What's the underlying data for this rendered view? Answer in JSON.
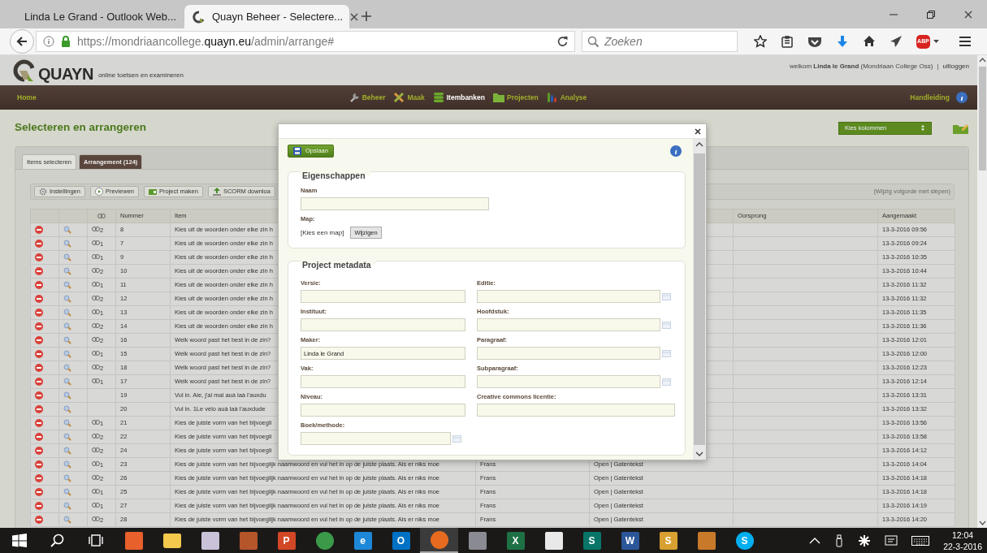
{
  "browser": {
    "tabs": [
      {
        "title": "Linda Le Grand - Outlook Web...",
        "selected": false
      },
      {
        "title": "Quayn Beheer - Selectere...",
        "selected": true
      }
    ],
    "url": {
      "prefix": "https://mondriaancollege.",
      "domain": "quayn.eu",
      "path": "/admin/arrange#"
    },
    "search": {
      "placeholder": "Zoeken"
    },
    "addon_badge": "ABP"
  },
  "header": {
    "logo_text": "QUAYN",
    "tagline": "online toetsen en examineren",
    "welcome": "welkom **Linda le Grand** (Mondriaan College Oss)",
    "separator": "|",
    "logout": "uitloggen"
  },
  "nav": {
    "home": "Home",
    "items": [
      {
        "label": "Beheer",
        "kind": "wrench",
        "selected": false
      },
      {
        "label": "Maak",
        "kind": "pencil",
        "selected": false
      },
      {
        "label": "Itembanken",
        "kind": "stack",
        "selected": true
      },
      {
        "label": "Projecten",
        "kind": "folder",
        "selected": false
      },
      {
        "label": "Analyse",
        "kind": "bars",
        "selected": false
      }
    ],
    "help": "Handleiding"
  },
  "page": {
    "title": "Selecteren en arrangeren",
    "column_picker": "Kies kolommen",
    "tabs": [
      {
        "label": "Items selecteren",
        "selected": false
      },
      {
        "label": "Arrangement (124)",
        "selected": true
      }
    ],
    "toolbar": [
      {
        "label": "Instellingen",
        "kind": "gear"
      },
      {
        "label": "Previewen",
        "kind": "play"
      },
      {
        "label": "Project maken",
        "kind": "project"
      },
      {
        "label": "SCORM downloa",
        "kind": "upload"
      }
    ],
    "hint": "(Wijzig volgorde met slepen)"
  },
  "table": {
    "columns": {
      "nummer": "Nummer",
      "item": "Item",
      "oorsprong": "Oorsprong",
      "aangemaakt": "Aangemaakt"
    },
    "rows": [
      {
        "links": "2",
        "nummer": "8",
        "item": "Kies uit de woorden onder elke zin h",
        "aangemaakt": "13-3-2016 09:56"
      },
      {
        "links": "1",
        "nummer": "7",
        "item": "Kies uit de woorden onder elke zin h",
        "aangemaakt": "13-3-2016 09:24"
      },
      {
        "links": "1",
        "nummer": "9",
        "item": "Kies uit de woorden onder elke zin h",
        "aangemaakt": "13-3-2016 10:35"
      },
      {
        "links": "2",
        "nummer": "10",
        "item": "Kies uit de woorden onder elke zin h",
        "aangemaakt": "13-3-2016 10:44"
      },
      {
        "links": "1",
        "nummer": "11",
        "item": "Kies uit de woorden onder elke zin h",
        "aangemaakt": "13-3-2016 11:32"
      },
      {
        "links": "2",
        "nummer": "12",
        "item": "Kies uit de woorden onder elke zin h",
        "aangemaakt": "13-3-2016 11:32"
      },
      {
        "links": "1",
        "nummer": "13",
        "item": "Kies uit de woorden onder elke zin h",
        "aangemaakt": "13-3-2016 11:35"
      },
      {
        "links": "2",
        "nummer": "14",
        "item": "Kies uit de woorden onder elke zin h",
        "aangemaakt": "13-3-2016 11:36"
      },
      {
        "links": "2",
        "nummer": "16",
        "item": "Welk woord past het best in de zin?",
        "aangemaakt": "13-3-2016 12:01"
      },
      {
        "links": "1",
        "nummer": "15",
        "item": "Welk woord past het best in de zin?",
        "aangemaakt": "13-3-2016 12:00"
      },
      {
        "links": "2",
        "nummer": "18",
        "item": "Welk woord past het best in de zin?",
        "aangemaakt": "13-3-2016 12:23"
      },
      {
        "links": "1",
        "nummer": "17",
        "item": "Welk woord past het best in de zin?",
        "aangemaakt": "13-3-2016 12:14"
      },
      {
        "nummer": "19",
        "item": "Vul in. Aie, j'ai mal auà laà l'auxdu",
        "aangemaakt": "13-3-2016 13:31"
      },
      {
        "nummer": "20",
        "item": "Vul in. 1Le vélo auà laà l'auxdude",
        "aangemaakt": "13-3-2016 13:32"
      },
      {
        "links": "1",
        "nummer": "21",
        "item": "Kies de juiste vorm van het bijvoegli",
        "aangemaakt": "13-3-2016 13:56"
      },
      {
        "links": "2",
        "nummer": "22",
        "item": "Kies de juiste vorm van het bijvoegli",
        "aangemaakt": "13-3-2016 13:58"
      },
      {
        "links": "2",
        "nummer": "24",
        "item": "Kies de juiste vorm van het bijvoegli",
        "aangemaakt": "13-3-2016 14:12"
      },
      {
        "links": "1",
        "nummer": "23",
        "item": "Kies de juiste vorm van het bijvoeglijk naamwoord en vul het in op de juiste plaats. Als er niks moe",
        "column_6": "Frans",
        "column_7": "Open | Gatentekst",
        "aangemaakt": "13-3-2016 14:04"
      },
      {
        "links": "2",
        "nummer": "26",
        "item": "Kies de juiste vorm van het bijvoeglijk naamwoord en vul het in op de juiste plaats. Als er niks moe",
        "column_6": "Frans",
        "column_7": "Open | Gatentekst",
        "aangemaakt": "13-3-2016 14:18"
      },
      {
        "links": "1",
        "nummer": "25",
        "item": "Kies de juiste vorm van het bijvoeglijk naamwoord en vul het in op de juiste plaats. Als er niks moe",
        "column_6": "Frans",
        "column_7": "Open | Gatentekst",
        "aangemaakt": "13-3-2016 14:18"
      },
      {
        "links": "1",
        "nummer": "27",
        "item": "Kies de juiste vorm van het bijvoeglijk naamwoord en vul het in op de juiste plaats. Als er niks moe",
        "column_6": "Frans",
        "column_7": "Open | Gatentekst",
        "aangemaakt": "13-3-2016 14:19"
      },
      {
        "links": "2",
        "nummer": "28",
        "item": "Kies de juiste vorm van het bijvoeglijk naamwoord en vul het in op de juiste plaats. Als er niks moe",
        "column_6": "Frans",
        "column_7": "Open | Gatentekst",
        "aangemaakt": "13-3-2016 14:20"
      }
    ]
  },
  "modal": {
    "save": "Opslaan",
    "properties": {
      "legend": "Eigenschappen",
      "name_label": "Naam",
      "folder_label": "Map:",
      "folder_value": "[Kies een map]",
      "change_button": "Wijzigen"
    },
    "metadata": {
      "legend": "Project metadata",
      "fields": [
        {
          "label": "Versie:",
          "picker": false
        },
        {
          "label": "Editie:",
          "picker": true
        },
        {
          "label": "Instituut:",
          "picker": false
        },
        {
          "label": "Hoofdstuk:",
          "picker": true
        },
        {
          "label": "Maker:",
          "value": "Linda le Grand",
          "picker": false
        },
        {
          "label": "Paragraaf:",
          "picker": true
        },
        {
          "label": "Vak:",
          "picker": false
        },
        {
          "label": "Subparagraaf:",
          "picker": true
        },
        {
          "label": "Niveau:",
          "picker": false
        },
        {
          "label": "Creative commons licentie:",
          "picker": false
        },
        {
          "label": "Boek/methode:",
          "picker": true
        }
      ]
    }
  },
  "taskbar": {
    "apps": [
      {
        "kind": "tile",
        "color": "#e8602c",
        "selected": false
      },
      {
        "kind": "folder",
        "color": "#f2c94c",
        "selected": false
      },
      {
        "kind": "tile",
        "color": "#c9c2d8",
        "selected": false
      },
      {
        "kind": "tile",
        "color": "#b5552a",
        "selected": false
      },
      {
        "kind": "tile",
        "color": "#d24726",
        "glyph": "P",
        "selected": false
      },
      {
        "kind": "circle",
        "color": "#3a9a4a",
        "selected": false
      },
      {
        "kind": "tile",
        "color": "#1e88d8",
        "glyph": "e",
        "selected": false
      },
      {
        "kind": "tile",
        "color": "#0072c6",
        "glyph": "O",
        "selected": false
      },
      {
        "kind": "circle",
        "color": "#e66a1f",
        "selected": true
      },
      {
        "kind": "tile",
        "color": "#8a8a92",
        "selected": false
      },
      {
        "kind": "tile",
        "color": "#1e7145",
        "glyph": "X",
        "selected": false
      },
      {
        "kind": "tile",
        "color": "#e9e9e9",
        "selected": false
      },
      {
        "kind": "tile",
        "color": "#077568",
        "glyph": "S",
        "selected": false
      },
      {
        "kind": "tile",
        "color": "#2b579a",
        "glyph": "W",
        "selected": false
      },
      {
        "kind": "tile",
        "color": "#d8a030",
        "glyph": "S",
        "selected": false
      },
      {
        "kind": "tile",
        "color": "#c87a2a",
        "selected": false
      },
      {
        "kind": "circle",
        "color": "#00aff0",
        "glyph": "S",
        "selected": false
      }
    ],
    "time": "12:04",
    "date": "22-3-2016"
  }
}
